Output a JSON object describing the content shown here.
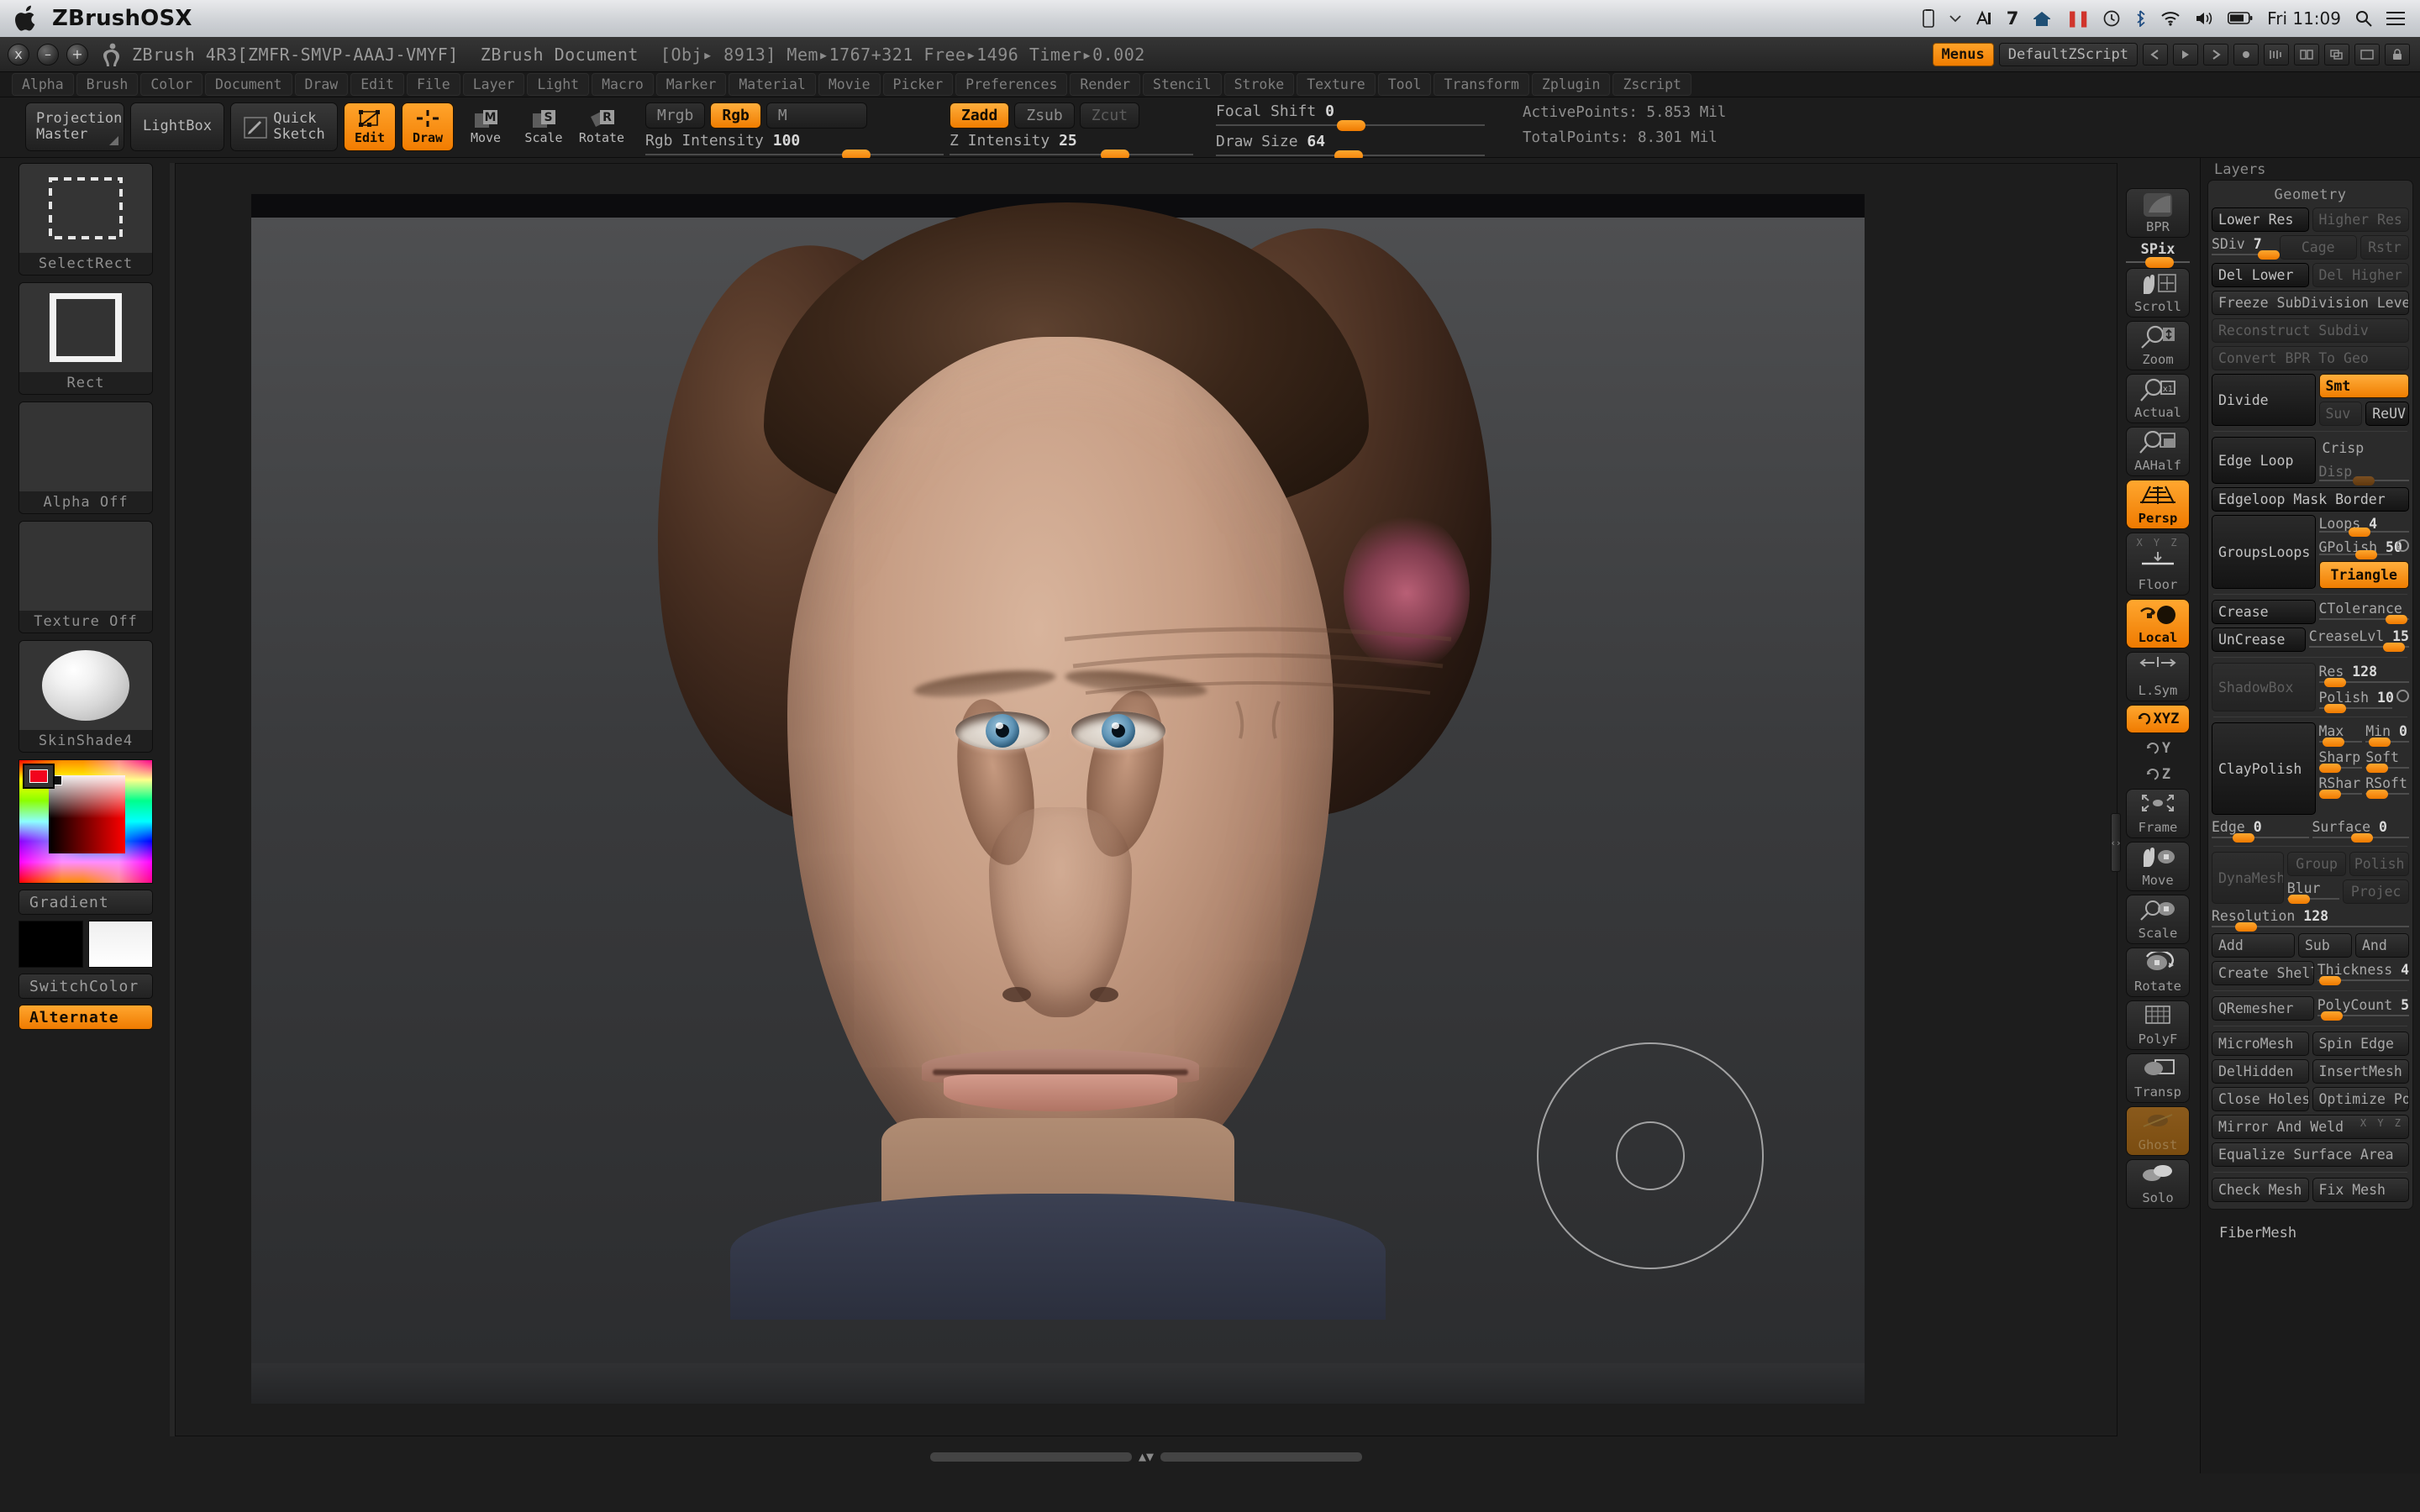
{
  "osx": {
    "app_name": "ZBrushOSX",
    "menu_extras": [
      "battery-icon",
      "chevron-down-icon",
      "A-icon",
      "7",
      "home-icon",
      "paused-icon",
      "timemachine-icon",
      "bluetooth-icon",
      "wifi-icon",
      "volume-icon",
      "battery2-icon"
    ],
    "spaces_number": "7",
    "clock": "Fri 11:09",
    "search_icon": "search-icon",
    "list_icon": "list-icon"
  },
  "titlebar": {
    "close": "x",
    "minimize": "–",
    "zoom": "+",
    "app_version": "ZBrush 4R3[ZMFR-SMVP-AAAJ-VMYF]",
    "document_name": "ZBrush Document",
    "stats": "[Obj▸ 8913]  Mem▸1767+321  Free▸1496  Timer▸0.002",
    "menus_button": "Menus",
    "zscript_button": "DefaultZScript"
  },
  "menu_items": [
    "Alpha",
    "Brush",
    "Color",
    "Document",
    "Draw",
    "Edit",
    "File",
    "Layer",
    "Light",
    "Macro",
    "Marker",
    "Material",
    "Movie",
    "Picker",
    "Preferences",
    "Render",
    "Stencil",
    "Stroke",
    "Texture",
    "Tool",
    "Transform",
    "Zplugin",
    "Zscript"
  ],
  "toolbar": {
    "projection_master": "Projection\nMaster",
    "projection_master_l1": "Projection",
    "projection_master_l2": "Master",
    "lightbox": "LightBox",
    "quick_sketch_l1": "Quick",
    "quick_sketch_l2": "Sketch",
    "edit": "Edit",
    "draw": "Draw",
    "move": "Move",
    "scale": "Scale",
    "rotate": "Rotate",
    "mrgb": "Mrgb",
    "rgb": "Rgb",
    "m": "M",
    "zadd": "Zadd",
    "zsub": "Zsub",
    "zcut": "Zcut",
    "rgb_intensity_label": "Rgb Intensity",
    "rgb_intensity_value": "100",
    "z_intensity_label": "Z Intensity",
    "z_intensity_value": "25",
    "focal_shift_label": "Focal Shift",
    "focal_shift_value": "0",
    "draw_size_label": "Draw Size",
    "draw_size_value": "64",
    "active_points": "ActivePoints: 5.853 Mil",
    "total_points": "TotalPoints: 8.301 Mil"
  },
  "left_palette": {
    "stroke": "SelectRect",
    "alpha_brush": "Rect",
    "alpha": "Alpha Off",
    "texture": "Texture Off",
    "material": "SkinShade4",
    "gradient": "Gradient",
    "switch_color": "SwitchColor",
    "alternate": "Alternate"
  },
  "right_strip": [
    {
      "label": "BPR",
      "icon": "bpr-render-icon",
      "state": "normal"
    },
    {
      "label": "SPix",
      "icon": "slider",
      "state": "slider"
    },
    {
      "label": "Scroll",
      "icon": "hand-scroll-icon",
      "state": "normal"
    },
    {
      "label": "Zoom",
      "icon": "magnifier-zoom-icon",
      "state": "normal"
    },
    {
      "label": "Actual",
      "icon": "magnifier-actual-icon",
      "state": "normal"
    },
    {
      "label": "AAHalf",
      "icon": "magnifier-aahalf-icon",
      "state": "normal"
    },
    {
      "label": "Persp",
      "icon": "perspective-grid-icon",
      "state": "active"
    },
    {
      "label": "Floor",
      "icon": "floor-grid-icon",
      "state": "normal"
    },
    {
      "label": "Local",
      "icon": "local-pivot-icon",
      "state": "active"
    },
    {
      "label": "L.Sym",
      "icon": "local-symmetry-icon",
      "state": "normal"
    },
    {
      "label": "XYZ",
      "icon": "rotate-xyz-icon",
      "state": "active"
    },
    {
      "label": "Y",
      "icon": "rotate-y-icon",
      "state": "flat"
    },
    {
      "label": "Z",
      "icon": "rotate-z-icon",
      "state": "flat"
    },
    {
      "label": "Frame",
      "icon": "frame-icon",
      "state": "normal"
    },
    {
      "label": "Move",
      "icon": "move-icon",
      "state": "normal"
    },
    {
      "label": "Scale",
      "icon": "scale-icon",
      "state": "normal"
    },
    {
      "label": "Rotate",
      "icon": "rotate-icon",
      "state": "normal"
    },
    {
      "label": "PolyF",
      "icon": "polyframe-icon",
      "state": "normal"
    },
    {
      "label": "Transp",
      "icon": "transparency-icon",
      "state": "normal"
    },
    {
      "label": "Ghost",
      "icon": "ghost-icon",
      "state": "dim"
    },
    {
      "label": "Solo",
      "icon": "solo-icon",
      "state": "normal"
    }
  ],
  "right_strip_spix_value": "SPix",
  "geometry": {
    "layers_label": "Layers",
    "title": "Geometry",
    "lower_res": "Lower Res",
    "higher_res": "Higher Res",
    "sdiv_label": "SDiv",
    "sdiv_value": "7",
    "cage": "Cage",
    "rstr": "Rstr",
    "del_lower": "Del Lower",
    "del_higher": "Del Higher",
    "freeze_subdivision": "Freeze SubDivision Levels",
    "reconstruct_subdiv": "Reconstruct Subdiv",
    "convert_bpr": "Convert BPR To Geo",
    "divide": "Divide",
    "smt": "Smt",
    "suv": "Suv",
    "reuv": "ReUV",
    "edge_loop": "Edge Loop",
    "crisp": "Crisp",
    "disp": "Disp",
    "edgeloop_mask_border": "Edgeloop Mask Border",
    "groupsloops": "GroupsLoops",
    "loops_label": "Loops",
    "loops_value": "4",
    "gpolish_label": "GPolish",
    "gpolish_value": "50",
    "triangle": "Triangle",
    "crease": "Crease",
    "ctolerance": "CTolerance",
    "uncrease": "UnCrease",
    "creaselvl_label": "CreaseLvl",
    "creaselvl_value": "15",
    "shadowbox": "ShadowBox",
    "res_label": "Res",
    "res_value": "128",
    "polish_label": "Polish",
    "polish_value": "10",
    "claypolish": "ClayPolish",
    "max": "Max",
    "min_label": "Min",
    "min_value": "0",
    "sharp": "Sharp",
    "soft": "Soft",
    "rshar": "RShar",
    "rsoft": "RSoft",
    "edge_label": "Edge",
    "edge_value": "0",
    "surface_label": "Surface",
    "surface_value": "0",
    "dynamesh": "DynaMesh",
    "group": "Group",
    "polish_btn": "Polish",
    "blur": "Blur",
    "project": "Projec",
    "resolution_label": "Resolution",
    "resolution_value": "128",
    "add": "Add",
    "sub": "Sub",
    "and": "And",
    "create_shell": "Create Shell",
    "thickness_label": "Thickness",
    "thickness_value": "4",
    "qremesher": "QRemesher",
    "polycount_label": "PolyCount",
    "polycount_value": "5",
    "micromesh": "MicroMesh",
    "spin_edge": "Spin Edge",
    "delhidden": "DelHidden",
    "insertmesh": "InsertMesh",
    "close_holes": "Close Holes",
    "optimize_points": "Optimize Poi",
    "mirror_and_weld": "Mirror And Weld",
    "mirror_axes": "X Y Z",
    "equalize_surface": "Equalize Surface Area",
    "check_mesh": "Check Mesh",
    "fix_mesh": "Fix Mesh",
    "fibermesh": "FiberMesh"
  },
  "colors": {
    "accent_orange": "#f07d00",
    "panel_bg": "#2b2b2b",
    "app_bg": "#1d1d1d",
    "text_gray": "#a9a9a9"
  }
}
